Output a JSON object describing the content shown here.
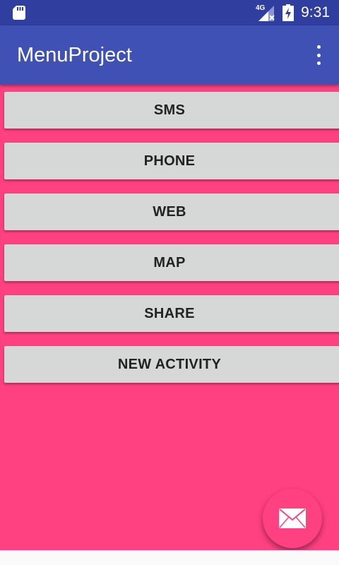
{
  "status_bar": {
    "network_label": "4G",
    "time": "9:31",
    "icons": [
      "sd-card-icon",
      "signal-icon",
      "battery-charging-icon"
    ]
  },
  "app_bar": {
    "title": "MenuProject",
    "overflow_icon": "more-vert-icon"
  },
  "buttons": [
    {
      "id": "sms",
      "label": "SMS"
    },
    {
      "id": "phone",
      "label": "PHONE"
    },
    {
      "id": "web",
      "label": "WEB"
    },
    {
      "id": "map",
      "label": "MAP"
    },
    {
      "id": "share",
      "label": "SHARE"
    },
    {
      "id": "new-activity",
      "label": "NEW ACTIVITY"
    }
  ],
  "fab": {
    "icon": "email-icon"
  },
  "colors": {
    "status_bar": "#303f9f",
    "primary": "#3f51b5",
    "accent": "#ff4081",
    "button": "#d6d7d7"
  }
}
